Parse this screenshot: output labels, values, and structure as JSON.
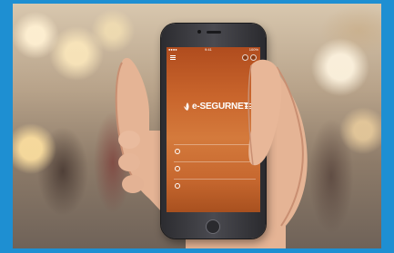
{
  "image": {
    "scene": "smartphone-in-hand",
    "border_color": "#1e8fd2",
    "screen_accent_color": "#c9652c"
  },
  "app": {
    "logo_text": "e-SEGURNET",
    "status_left": "●●●●",
    "status_time": "9:41",
    "status_battery": "100%",
    "menu_items": [
      {
        "label": "",
        "sub": ""
      },
      {
        "label": "",
        "sub": ""
      },
      {
        "label": "",
        "sub": ""
      }
    ]
  },
  "icons": {
    "menu": "hamburger-icon",
    "logo_mark": "lotus-icon",
    "top_right": [
      "settings-icon",
      "profile-icon"
    ]
  }
}
